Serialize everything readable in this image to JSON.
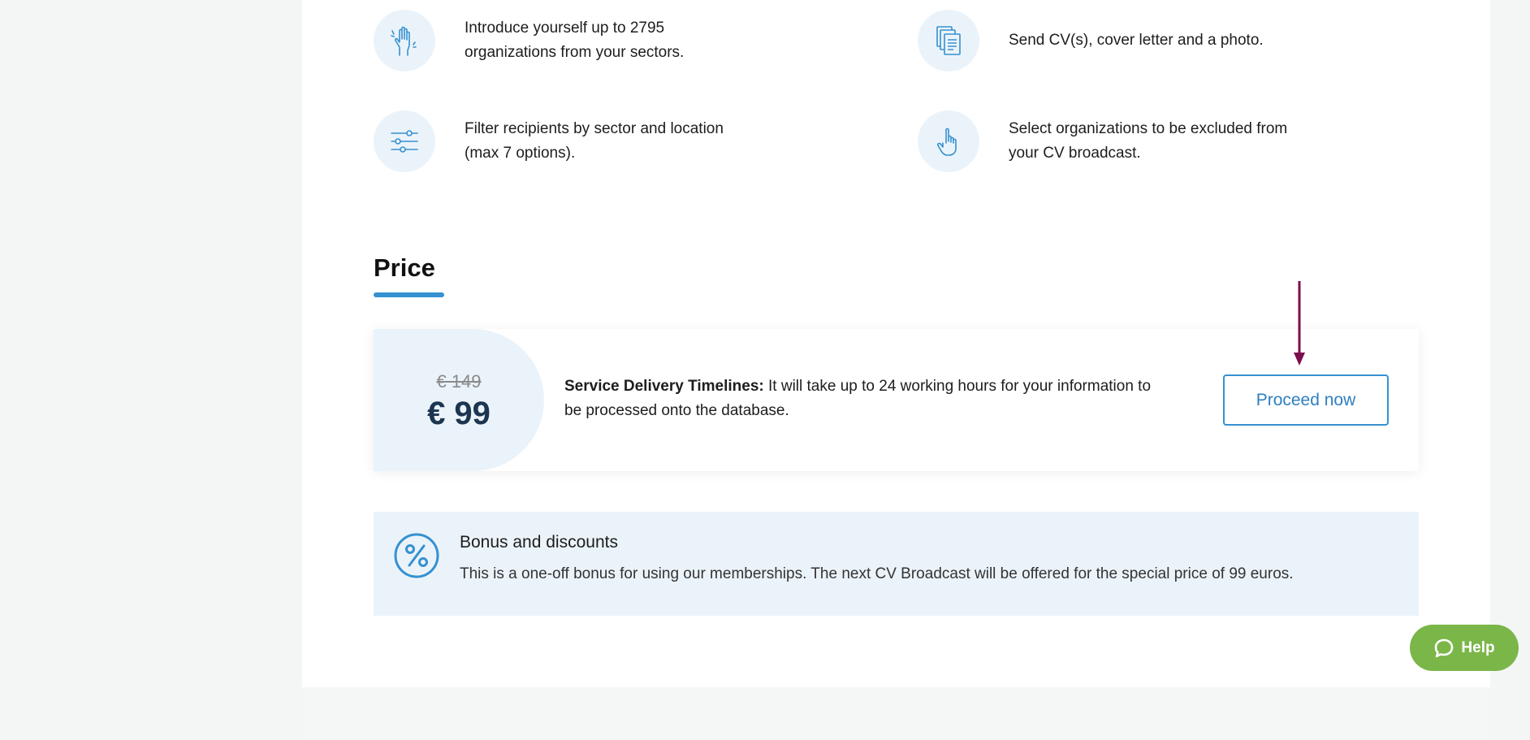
{
  "features": [
    {
      "icon": "hand-wave-icon",
      "text": "Introduce yourself up to 2795 organizations from your sectors."
    },
    {
      "icon": "documents-icon",
      "text": "Send CV(s), cover letter and a photo."
    },
    {
      "icon": "sliders-icon",
      "text": "Filter recipients by sector and location (max 7 options)."
    },
    {
      "icon": "pointer-hand-icon",
      "text": "Select organizations to be excluded from your CV broadcast."
    }
  ],
  "price": {
    "heading": "Price",
    "old_price": "€ 149",
    "new_price": "€ 99",
    "delivery_label": "Service Delivery Timelines:",
    "delivery_text": " It will take up to 24 working hours for your information to be processed onto the database.",
    "proceed_label": "Proceed now"
  },
  "bonus": {
    "icon": "percent-icon",
    "title": "Bonus and discounts",
    "text": "This is a one-off bonus for using our memberships. The next CV Broadcast will be offered for the special price of 99 euros."
  },
  "help": {
    "label": "Help",
    "icon": "chat-bubble-icon"
  },
  "colors": {
    "accent": "#3591d0",
    "help_green": "#7ab648",
    "arrow": "#7a0f4f",
    "price_dark": "#1c3550"
  }
}
